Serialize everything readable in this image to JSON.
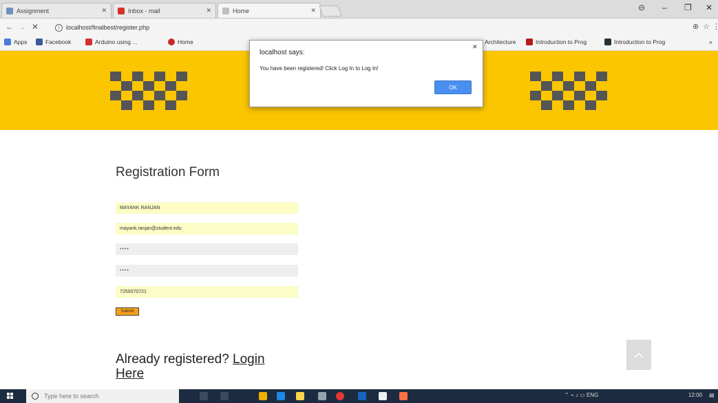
{
  "browser": {
    "tabs": [
      {
        "title": "Assignment",
        "favicon_color": "#6f8fbf",
        "active": false
      },
      {
        "title": "Inbox - mail",
        "favicon_color": "#d93025",
        "active": false
      },
      {
        "title": "Home",
        "favicon_color": "#bfbfbf",
        "active": true
      }
    ],
    "url": "localhost/finalbest/register.php",
    "bookmarks": [
      {
        "label": "Apps",
        "color": "#4a7bd6"
      },
      {
        "label": "Facebook",
        "color": "#3b5998"
      },
      {
        "label": "Arduino using ...",
        "color": "#d32f2f"
      },
      {
        "label": "Home",
        "color": "#c62828"
      },
      {
        "label": "Architecture",
        "color": "#2e4f9a"
      },
      {
        "label": "Introduction to Prog",
        "color": "#b71c1c"
      },
      {
        "label": "Introduction to Prog",
        "color": "#263238"
      }
    ]
  },
  "alert": {
    "title": "localhost says:",
    "message": "You have been registered! Click Log In to Log In!",
    "ok_label": "OK"
  },
  "form": {
    "heading": "Registration Form",
    "name_value": "MAYANK RANJAN",
    "email_value": "mayank.ranjan@student.edu",
    "password_mask": "••••",
    "confirm_mask": "••••",
    "phone_value": "7250070721",
    "submit_label": "Submit"
  },
  "login_prompt": {
    "text": "Already registered? ",
    "link_label": "Login Here"
  },
  "taskbar": {
    "search_placeholder": "Type here to search",
    "clock": "12:00"
  },
  "colors": {
    "banner": "#fbc600",
    "checker": "#555555",
    "alert_ok": "#4a8ff0",
    "submit": "#f59f1c"
  }
}
